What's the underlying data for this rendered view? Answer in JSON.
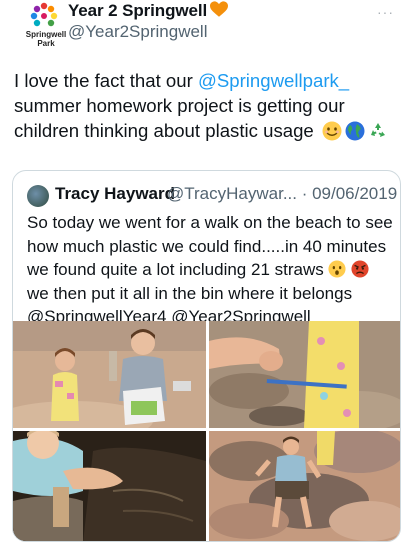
{
  "tweet": {
    "display_name": "Year 2 Springwell",
    "handle": "@Year2Springwell",
    "avatar_label": "Springwell\nPark",
    "more_label": "···",
    "text_intro": "I love the fact that our ",
    "text_mention": "@Springwellpark_",
    "text_rest": " summer homework project is getting our children thinking about plastic usage",
    "emoji_icons": [
      "smiling-face-icon",
      "globe-icon",
      "recycle-icon"
    ]
  },
  "quoted_tweet": {
    "display_name": "Tracy Hayward",
    "handle_date": "@TracyHaywar... · 09/06/2019",
    "text_part1": "So today we went for a walk on the beach to see how much plastic we could find.....in 40 minutes we found quite a lot including 21 straws",
    "text_part2": " we then put it all in the bin where it belongs @SpringwellYear4 @Year2Springwell",
    "emoji_icons": [
      "worried-face-icon",
      "angry-face-icon"
    ],
    "photos": [
      {
        "label": "photo-children-holding-plastic"
      },
      {
        "label": "photo-hand-holding-straw"
      },
      {
        "label": "photo-child-on-seaweed"
      },
      {
        "label": "photo-boy-sitting-on-rocks"
      }
    ]
  },
  "colors": {
    "link": "#1d9bf0",
    "secondary_text": "#536471",
    "border": "#cfd9de",
    "heart": "#f4900c"
  }
}
